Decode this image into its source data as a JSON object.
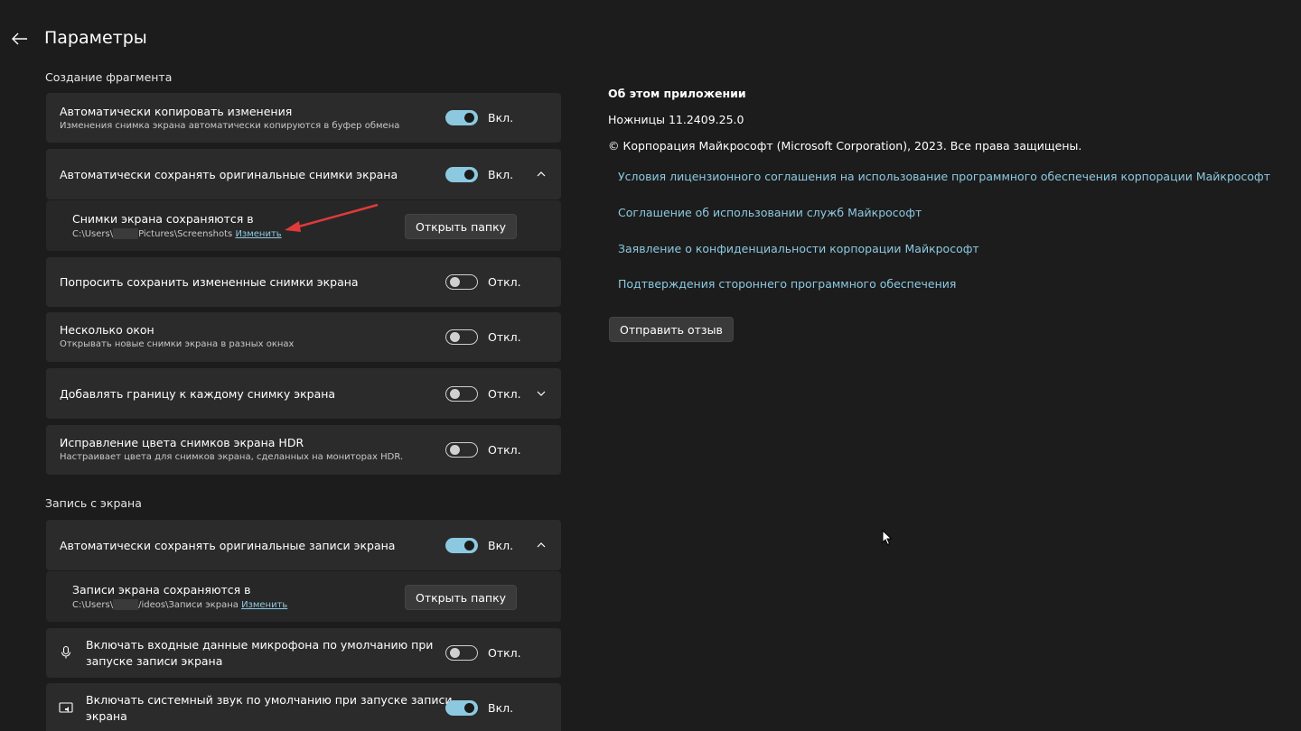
{
  "header": {
    "title": "Параметры"
  },
  "snip_section": {
    "title": "Создание фрагмента",
    "auto_copy": {
      "title": "Автоматически копировать изменения",
      "desc": "Изменения снимка экрана автоматически копируются в буфер обмена",
      "state": "Вкл."
    },
    "auto_save": {
      "title": "Автоматически сохранять оригинальные снимки экрана",
      "state": "Вкл."
    },
    "save_location": {
      "title": "Снимки экрана сохраняются в",
      "path_prefix": "C:\\Users\\",
      "path_suffix": "Pictures\\Screenshots",
      "change_link": "Изменить",
      "open_button": "Открыть папку"
    },
    "ask_save": {
      "title": "Попросить сохранить измененные снимки экрана",
      "state": "Откл."
    },
    "multi_window": {
      "title": "Несколько окон",
      "desc": "Открывать новые снимки экрана в разных окнах",
      "state": "Откл."
    },
    "add_border": {
      "title": "Добавлять границу к каждому снимку экрана",
      "state": "Откл."
    },
    "hdr": {
      "title": "Исправление цвета снимков экрана HDR",
      "desc": "Настраивает цвета для снимков экрана, сделанных на мониторах HDR.",
      "state": "Откл."
    }
  },
  "record_section": {
    "title": "Запись с экрана",
    "auto_save": {
      "title": "Автоматически сохранять оригинальные записи экрана",
      "state": "Вкл."
    },
    "save_location": {
      "title": "Записи экрана сохраняются в",
      "path_prefix": "C:\\Users\\",
      "path_suffix": "/ideos\\Записи экрана",
      "change_link": "Изменить",
      "open_button": "Открыть папку"
    },
    "mic": {
      "title_line1": "Включать входные данные микрофона по умолчанию при",
      "title_line2": "запуске записи экрана",
      "state": "Откл."
    },
    "system_audio": {
      "title_line1": "Включать системный звук по умолчанию при запуске записи",
      "title_line2": "экрана",
      "state": "Вкл."
    }
  },
  "about": {
    "heading": "Об этом приложении",
    "version": "Ножницы 11.2409.25.0",
    "copyright": "© Корпорация Майкрософт (Microsoft Corporation), 2023. Все права защищены.",
    "links": [
      "Условия лицензионного соглашения на использование программного обеспечения корпорации Майкрософт",
      "Соглашение об использовании служб Майкрософт",
      "Заявление о конфиденциальности корпорации Майкрософт",
      "Подтверждения стороннего программного обеспечения"
    ],
    "feedback_button": "Отправить отзыв"
  },
  "colors": {
    "accent": "#8cc9e0",
    "background": "#1c1c1c",
    "card": "#2b2b2b",
    "annotation_arrow": "#e03a3a"
  }
}
